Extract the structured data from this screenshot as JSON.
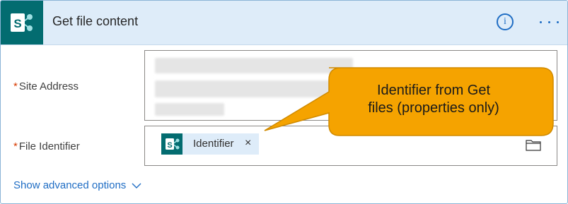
{
  "action": {
    "title": "Get file content",
    "connector_icon": "sharepoint-icon",
    "info_icon": "info-icon",
    "info_glyph": "i",
    "more_icon": "more-options-icon"
  },
  "fields": {
    "required_marker": "*",
    "site_address": {
      "label": "Site Address",
      "value_hidden": true
    },
    "file_identifier": {
      "label": "File Identifier",
      "token": {
        "text": "Identifier",
        "icon": "sharepoint-icon",
        "remove": "×"
      },
      "picker_icon": "folder-icon"
    }
  },
  "advanced": {
    "label": "Show advanced options",
    "icon": "chevron-down-icon"
  },
  "callout": {
    "text": "Identifier from Get\nfiles (properties only)"
  },
  "colors": {
    "header_bg": "#deecf9",
    "sharepoint": "#036c70",
    "accent": "#1f6dc4",
    "required": "#d83b01",
    "callout": "#f5a300",
    "callout_border": "#d08a00"
  }
}
